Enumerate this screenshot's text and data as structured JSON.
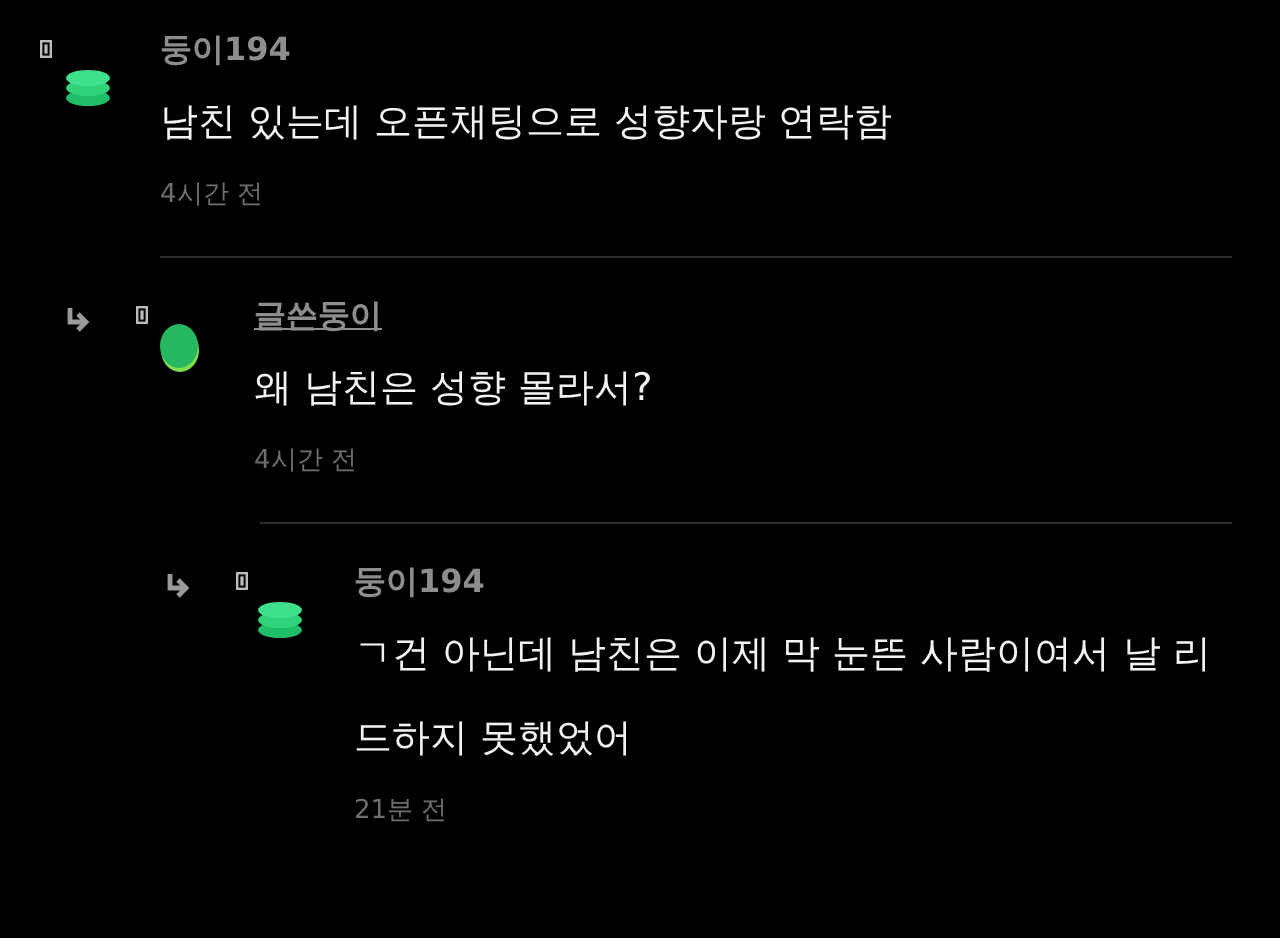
{
  "comments": [
    {
      "kind": "stack",
      "author": false,
      "name": "둥이194",
      "text": "남친 있는데 오픈채팅으로 성향자랑 연락함",
      "time": "4시간 전",
      "children": [
        {
          "kind": "oval",
          "author": true,
          "name": "글쓴둥이",
          "text": "왜 남친은 성향 몰라서?",
          "time": "4시간 전",
          "children": [
            {
              "kind": "stack",
              "author": false,
              "name": "둥이194",
              "text": "ㄱ건 아닌데 남친은 이제 막 눈뜬 사람이여서 날 리드하지 못했었어",
              "time": "21분 전"
            }
          ]
        }
      ]
    }
  ]
}
